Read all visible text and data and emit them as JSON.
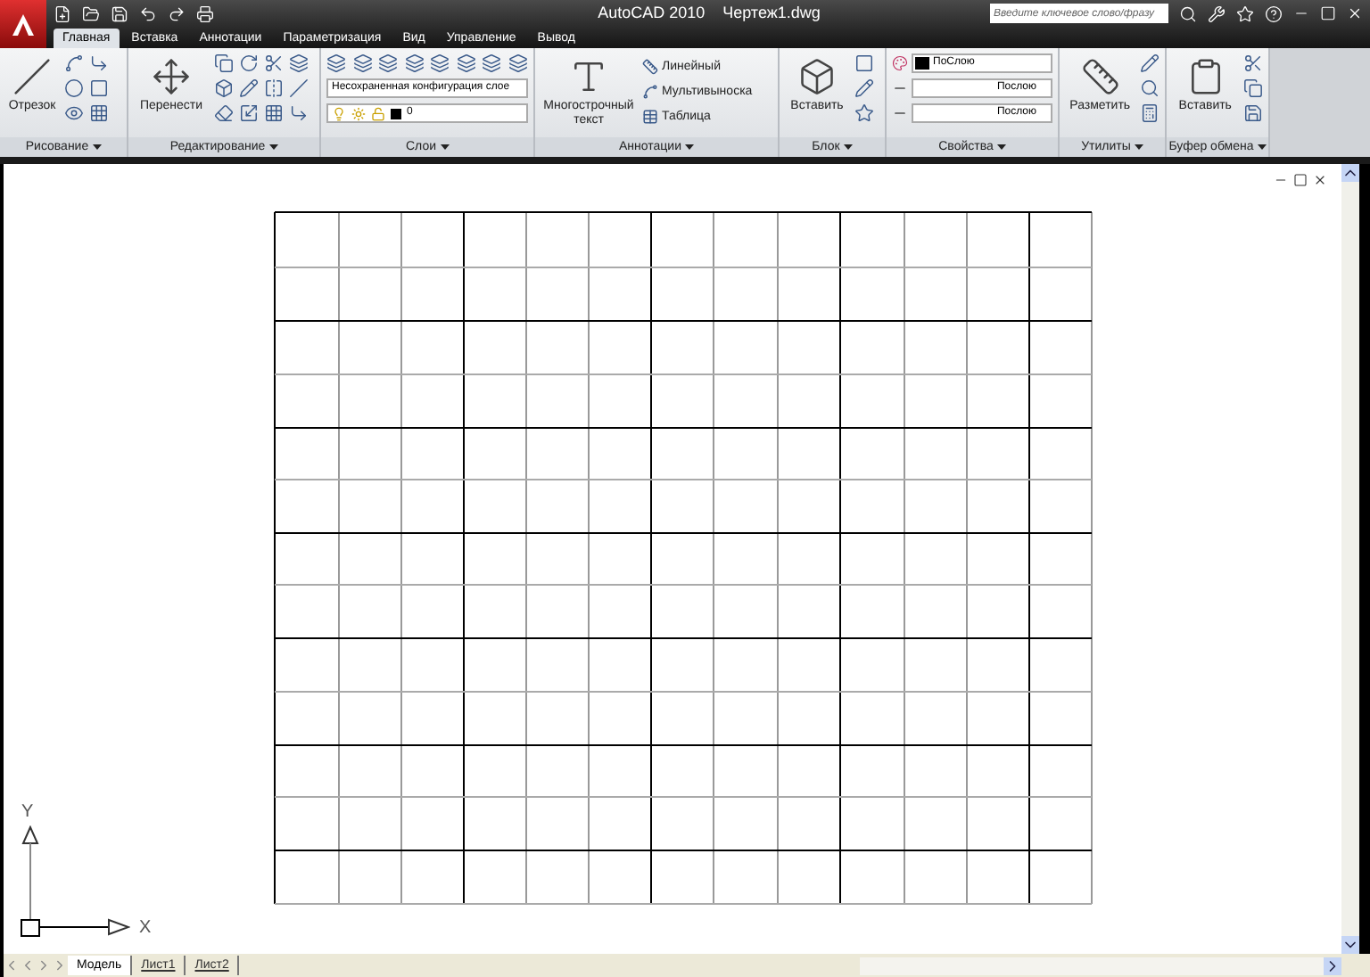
{
  "window": {
    "app": "AutoCAD 2010",
    "document": "Чертеж1.dwg"
  },
  "search": {
    "placeholder": "Введите ключевое слово/фразу"
  },
  "tabs": [
    {
      "label": "Главная",
      "selected": true
    },
    {
      "label": "Вставка",
      "selected": false
    },
    {
      "label": "Аннотации",
      "selected": false
    },
    {
      "label": "Параметризация",
      "selected": false
    },
    {
      "label": "Вид",
      "selected": false
    },
    {
      "label": "Управление",
      "selected": false
    },
    {
      "label": "Вывод",
      "selected": false
    }
  ],
  "ribbon": {
    "draw": {
      "title": "Рисование",
      "button": "Отрезок"
    },
    "modify": {
      "title": "Редактирование",
      "button": "Перенести"
    },
    "layers": {
      "title": "Слои",
      "layer_state": "Несохраненная конфигурация слое",
      "current_layer": "0"
    },
    "annotation": {
      "title": "Аннотации",
      "button": "Многострочный текст",
      "items": [
        "Линейный",
        "Мультивыноска",
        "Таблица"
      ]
    },
    "block": {
      "title": "Блок",
      "button": "Вставить"
    },
    "properties": {
      "title": "Свойства",
      "color_label": "ПоСлою",
      "linetype": "Послою",
      "lineweight": "Послою"
    },
    "utilities": {
      "title": "Утилиты",
      "button": "Разметить"
    },
    "clipboard": {
      "title": "Буфер обмена",
      "button": "Вставить"
    }
  },
  "ucs": {
    "x_label": "X",
    "y_label": "Y"
  },
  "layout_tabs": [
    {
      "label": "Модель",
      "selected": true
    },
    {
      "label": "Лист1",
      "selected": false
    },
    {
      "label": "Лист2",
      "selected": false
    }
  ]
}
